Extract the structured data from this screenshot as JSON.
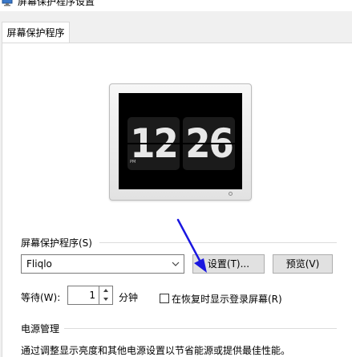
{
  "window": {
    "title": "屏幕保护程序设置",
    "icon": "monitor-icon"
  },
  "tabs": [
    {
      "label": "屏幕保护程序",
      "active": true
    }
  ],
  "preview": {
    "hour": "12",
    "minute": "26",
    "ampm": "PM"
  },
  "screensaver": {
    "group_label": "屏幕保护程序(S)",
    "selected": "Fliqlo",
    "settings_label": "设置(T)...",
    "preview_label": "预览(V)",
    "wait_label": "等待(W):",
    "wait_value": "1",
    "minutes_label": "分钟",
    "resume_checkbox_label": "在恢复时显示登录屏幕(R)",
    "resume_checked": false
  },
  "power": {
    "group_label": "电源管理",
    "description": "通过调整显示亮度和其他电源设置以节省能源或提供最佳性能。"
  },
  "colors": {
    "annotation_arrow": "#1a17e0",
    "window_bg": "#f0f0f0"
  }
}
